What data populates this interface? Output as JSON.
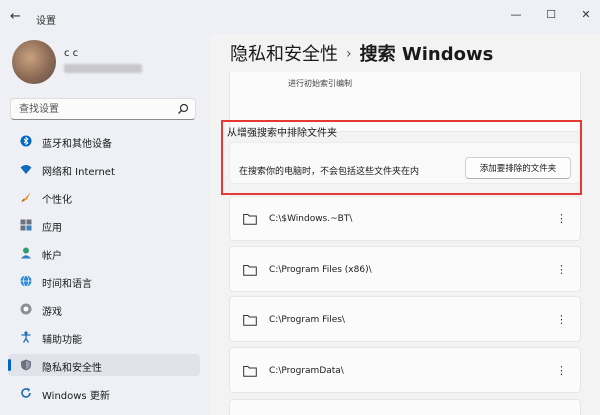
{
  "window": {
    "title": "设置",
    "back": "←",
    "minimize": "—",
    "maximize": "☐",
    "close": "✕"
  },
  "user": {
    "name": "c c"
  },
  "search": {
    "placeholder": "查找设置"
  },
  "sidebar": {
    "items": [
      {
        "label": "蓝牙和其他设备",
        "icon": "bluetooth-icon"
      },
      {
        "label": "网络和 Internet",
        "icon": "wifi-icon"
      },
      {
        "label": "个性化",
        "icon": "brush-icon"
      },
      {
        "label": "应用",
        "icon": "apps-icon"
      },
      {
        "label": "帐户",
        "icon": "account-icon"
      },
      {
        "label": "时间和语言",
        "icon": "globe-clock-icon"
      },
      {
        "label": "游戏",
        "icon": "gamepad-icon"
      },
      {
        "label": "辅助功能",
        "icon": "accessibility-icon"
      },
      {
        "label": "隐私和安全性",
        "icon": "shield-icon",
        "active": true
      },
      {
        "label": "Windows 更新",
        "icon": "update-icon"
      }
    ]
  },
  "header": {
    "parent": "隐私和安全性",
    "separator": "›",
    "current": "搜索 Windows"
  },
  "top_card": {
    "text": "进行初始索引编制"
  },
  "exclude": {
    "section_title": "从增强搜索中排除文件夹",
    "description": "在搜索你的电脑时，不会包括这些文件夹在内",
    "add_button": "添加要排除的文件夹"
  },
  "folders": [
    {
      "path": "C:\\$Windows.~BT\\"
    },
    {
      "path": "C:\\Program Files (x86)\\"
    },
    {
      "path": "C:\\Program Files\\"
    },
    {
      "path": "C:\\ProgramData\\"
    }
  ],
  "more_glyph": "⋮",
  "colors": {
    "accent": "#0067c0",
    "highlight_border": "#e53935"
  }
}
